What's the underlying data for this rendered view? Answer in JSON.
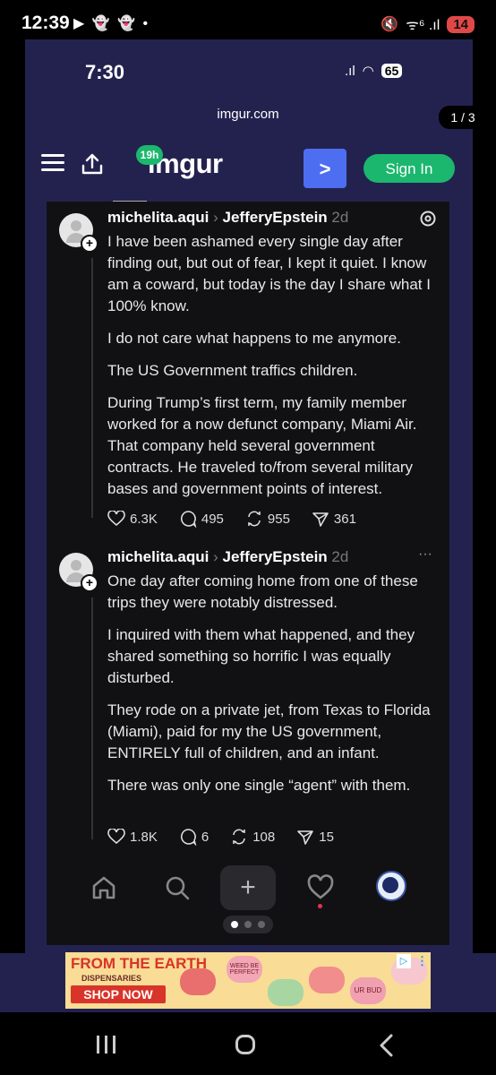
{
  "status_bar": {
    "time": "12:39",
    "icons": "▶ 👻 👻 •",
    "signal": "ᯤ⁶ .ıl",
    "battery": "14"
  },
  "inner_status": {
    "time": "7:30",
    "battery": "65"
  },
  "browser": {
    "url": "imgur.com",
    "pager": "1 / 3"
  },
  "imgur": {
    "logo": "imgur",
    "badge": "19h",
    "next_label": ">",
    "signin_label": "Sign In"
  },
  "posts": [
    {
      "user": "michelita.aqui",
      "reply_to": "JefferyEpstein",
      "age": "2d",
      "paragraphs": [
        "I have been ashamed every single day after finding out, but out of fear, I kept it quiet. I know am a coward, but today is the day I share what I 100% know.",
        "I do not care what happens to me anymore.",
        "The US Government traffics children.",
        "During Trump’s first term, my family member worked for a now defunct company, Miami Air. That company held several government contracts. He traveled to/from several military bases and government points of interest."
      ],
      "likes": "6.3K",
      "comments": "495",
      "reposts": "955",
      "shares": "361"
    },
    {
      "user": "michelita.aqui",
      "reply_to": "JefferyEpstein",
      "age": "2d",
      "paragraphs": [
        "One day after coming home from one of these trips they were notably distressed.",
        "I inquired with them what happened, and they shared something so horrific I was equally disturbed.",
        "They rode on a private jet, from Texas to Florida (Miami), paid for my the US government, ENTIRELY full of children, and an infant.",
        "There was only one single “agent” with them."
      ],
      "likes": "1.8K",
      "comments": "6",
      "reposts": "108",
      "shares": "15"
    }
  ],
  "ad": {
    "brand_line1": "FROM THE EARTH",
    "brand_line2": "DISPENSARIES",
    "button": "SHOP NOW",
    "heart1": "WEED BE PERFECT",
    "heart2": "UR BUD"
  }
}
